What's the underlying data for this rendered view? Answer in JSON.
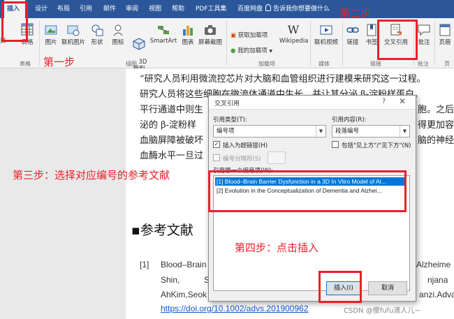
{
  "tabs": [
    "插入",
    "设计",
    "布局",
    "引用",
    "邮件",
    "审阅",
    "视图",
    "帮助",
    "PDF工具集",
    "百度网盘"
  ],
  "tell_me": "告诉我你想要做什么",
  "ribbon": {
    "table_label": "表格",
    "table_group": "表格",
    "pictures": "图片",
    "online_pictures": "联机图片",
    "shapes": "形状",
    "icons": "图标",
    "model3d": "3D\n模型",
    "smartart": "SmartArt",
    "chart": "图表",
    "screenshot": "屏幕截图",
    "illustrations_group": "插图",
    "get_addins": "获取加载项",
    "my_addins": "我的加载项",
    "wikipedia": "Wikipedia",
    "addins_group": "加载项",
    "online_video": "联机视频",
    "media_group": "媒体",
    "link": "链接",
    "bookmark": "书签",
    "cross_ref": "交叉引用",
    "links_group": "链接",
    "comment": "批注",
    "comments_group": "批注",
    "header": "页眉",
    "left_clip": "页",
    "left_clip2": "页"
  },
  "annotations": {
    "step1": "第一步",
    "step2": "第二步",
    "step3": "第三步：选择对应编号的参考文献",
    "step4": "第四步：点击插入"
  },
  "document": {
    "lines": [
      "“研究人员利用微流控芯片对大脑和血管组织进行建模来研究这一过程。",
      "研究人员将这些细胞在微流体通道中生长，并让其分泌 β-淀粉样蛋白。",
      "平行通道中则生",
      "泌的 β-淀粉样",
      "血脑屏障被破坏",
      "血酶水平一旦过"
    ],
    "right_fragments": [
      "胞。之后",
      "得更加容",
      "脑的神经"
    ],
    "ref_heading": "参考文献",
    "ref_num": "[1]",
    "ref_line1a": "Blood–Brain",
    "ref_line1b": "Alzheime",
    "ref_line2a": "Shin,",
    "ref_line2b": "S",
    "ref_line2c": "njana",
    "ref_line3a": "AhKim,Seok",
    "ref_line3b": "anzi.Advan",
    "ref_link": "https://doi.org/10.1002/advs.201900962",
    "watermark": "CSDN @傻fufu滴人儿~"
  },
  "dialog": {
    "title": "交叉引用",
    "help": "?",
    "close": "✕",
    "ref_type_label": "引用类型(T):",
    "ref_type_value": "编号项",
    "ref_content_label": "引用内容(R):",
    "ref_content_value": "段落编号",
    "insert_hyperlink": "插入为超链接(H)",
    "include_above_below": "包括\"见上方\"/\"见下方\"(N)",
    "separator_label": "编号分隔符(S)",
    "which_item_label": "引用哪一个编号项(W):",
    "items": [
      "[1] Blood–Brain Barrier Dysfunction in a 3D In Vitro Model of Al...",
      "[2] Evolution in the Conceptualization of Dementia and Alzhei..."
    ],
    "insert_button": "插入(I)",
    "cancel_button": "取消"
  }
}
